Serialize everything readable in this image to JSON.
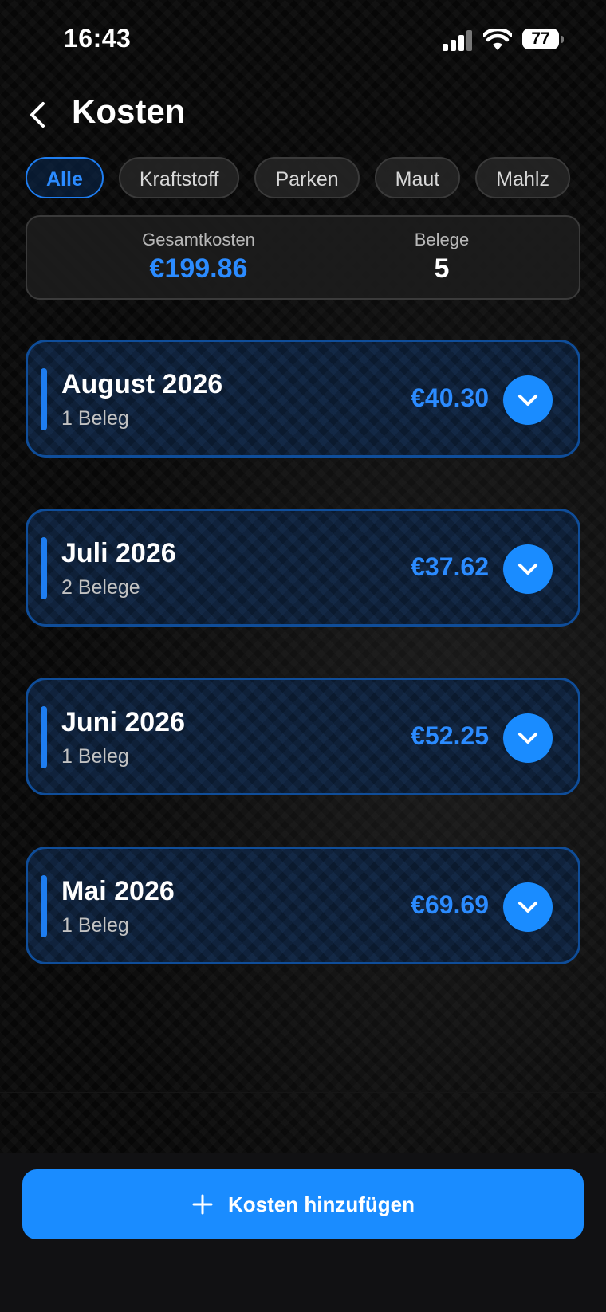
{
  "status_bar": {
    "time": "16:43",
    "battery": "77"
  },
  "header": {
    "title": "Kosten"
  },
  "filters": [
    {
      "label": "Alle",
      "active": true
    },
    {
      "label": "Kraftstoff",
      "active": false
    },
    {
      "label": "Parken",
      "active": false
    },
    {
      "label": "Maut",
      "active": false
    },
    {
      "label": "Mahlz",
      "active": false
    }
  ],
  "summary": {
    "total_label": "Gesamtkosten",
    "total_value": "€199.86",
    "receipts_label": "Belege",
    "receipts_value": "5"
  },
  "months": [
    {
      "name": "August 2026",
      "count": "1 Beleg",
      "total": "€40.30"
    },
    {
      "name": "Juli 2026",
      "count": "2 Belege",
      "total": "€37.62"
    },
    {
      "name": "Juni 2026",
      "count": "1 Beleg",
      "total": "€52.25"
    },
    {
      "name": "Mai 2026",
      "count": "1 Beleg",
      "total": "€69.69"
    }
  ],
  "footer": {
    "add_button_label": "Kosten hinzufügen"
  },
  "colors": {
    "accent": "#1a8cff",
    "card_border": "#0f4d99",
    "background": "#070707"
  }
}
